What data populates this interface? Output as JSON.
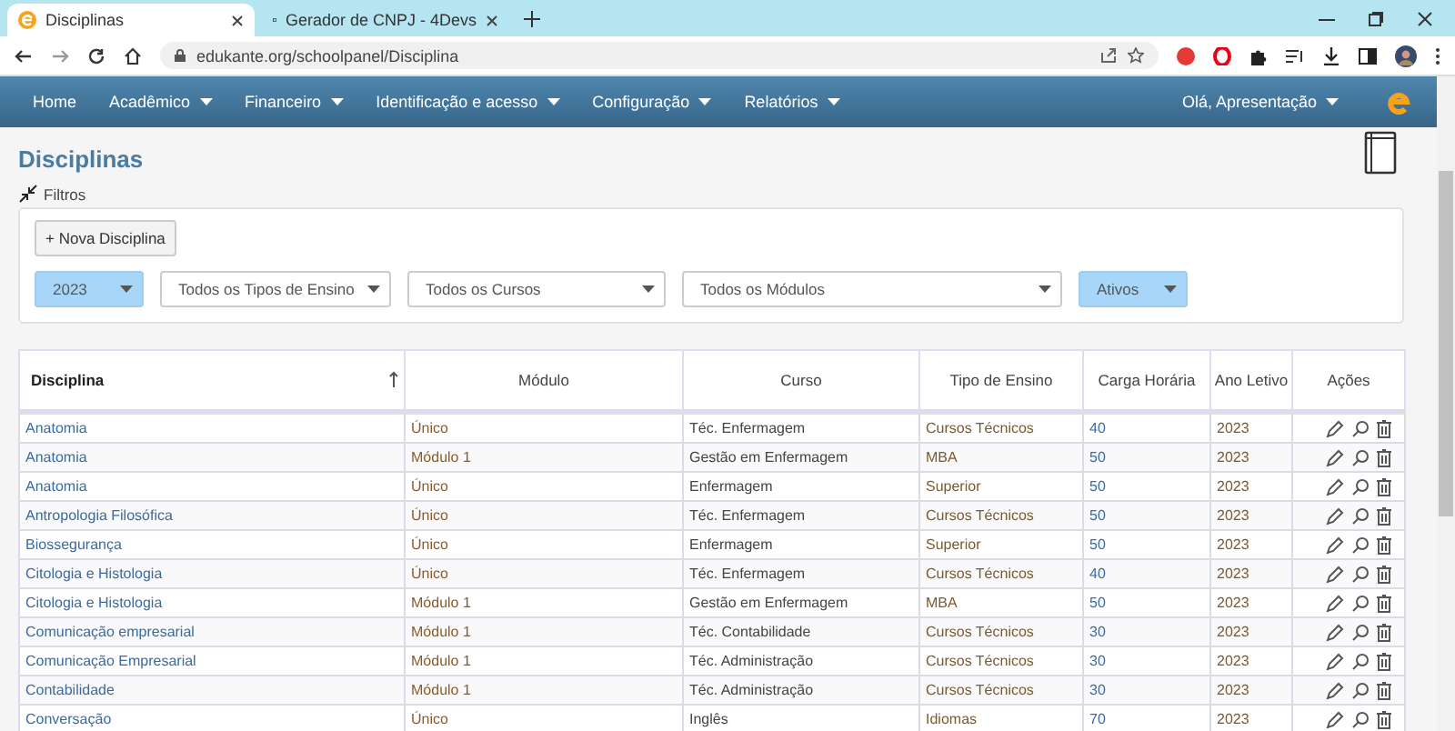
{
  "browser": {
    "tabs": [
      {
        "title": "Disciplinas",
        "selected": true
      },
      {
        "title": "Gerador de CNPJ - 4Devs",
        "selected": false
      }
    ],
    "url": "edukante.org/schoolpanel/Disciplina"
  },
  "nav": {
    "items": [
      "Home",
      "Acadêmico",
      "Financeiro",
      "Identificação e acesso",
      "Configuração",
      "Relatórios"
    ],
    "user": "Olá, Apresentação"
  },
  "page": {
    "title": "Disciplinas",
    "filters_label": "Filtros",
    "new_button": "+ Nova Disciplina",
    "filters": [
      {
        "value": "2023",
        "highlighted": true
      },
      {
        "value": "Todos os Tipos de Ensino",
        "highlighted": false
      },
      {
        "value": "Todos os Cursos",
        "highlighted": false
      },
      {
        "value": "Todos os Módulos",
        "highlighted": false
      },
      {
        "value": "Ativos",
        "highlighted": true
      }
    ]
  },
  "table": {
    "columns": [
      "Disciplina",
      "Módulo",
      "Curso",
      "Tipo de Ensino",
      "Carga Horária",
      "Ano Letivo",
      "Ações"
    ],
    "rows": [
      [
        "Anatomia",
        "Único",
        "Téc. Enfermagem",
        "Cursos Técnicos",
        "40",
        "2023"
      ],
      [
        "Anatomia",
        "Módulo 1",
        "Gestão em Enfermagem",
        "MBA",
        "50",
        "2023"
      ],
      [
        "Anatomia",
        "Único",
        "Enfermagem",
        "Superior",
        "50",
        "2023"
      ],
      [
        "Antropologia Filosófica",
        "Único",
        "Téc. Enfermagem",
        "Cursos Técnicos",
        "50",
        "2023"
      ],
      [
        "Biossegurança",
        "Único",
        "Enfermagem",
        "Superior",
        "50",
        "2023"
      ],
      [
        "Citologia e Histologia",
        "Único",
        "Téc. Enfermagem",
        "Cursos Técnicos",
        "40",
        "2023"
      ],
      [
        "Citologia e Histologia",
        "Módulo 1",
        "Gestão em Enfermagem",
        "MBA",
        "50",
        "2023"
      ],
      [
        "Comunicação empresarial",
        "Módulo 1",
        "Téc. Contabilidade",
        "Cursos Técnicos",
        "30",
        "2023"
      ],
      [
        "Comunicação Empresarial",
        "Módulo 1",
        "Téc. Administração",
        "Cursos Técnicos",
        "30",
        "2023"
      ],
      [
        "Contabilidade",
        "Módulo 1",
        "Téc. Administração",
        "Cursos Técnicos",
        "30",
        "2023"
      ],
      [
        "Conversação",
        "Único",
        "Inglês",
        "Idiomas",
        "70",
        "2023"
      ]
    ]
  }
}
